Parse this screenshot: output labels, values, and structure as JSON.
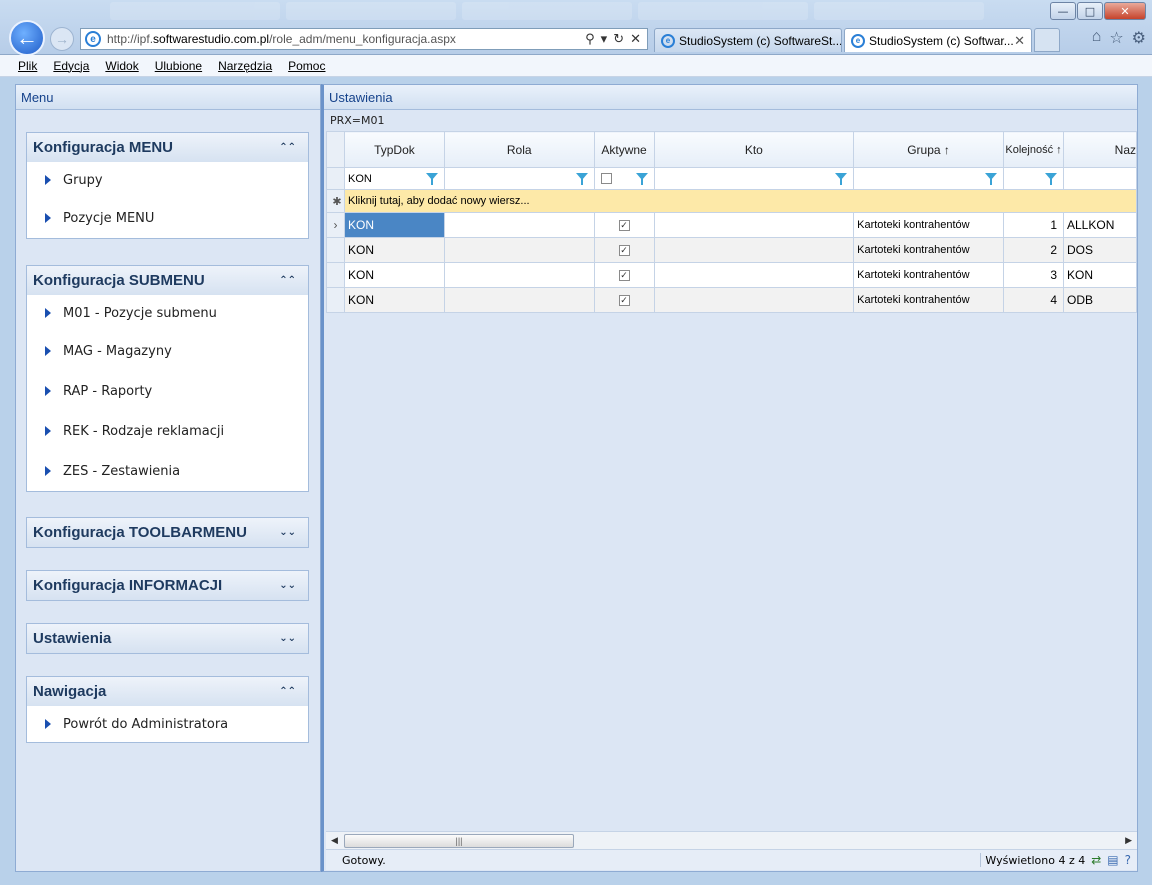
{
  "browser": {
    "url_prefix": "http://ipf.",
    "url_host": "softwarestudio.com.pl",
    "url_path": "/role_adm/menu_konfiguracja.aspx",
    "tabs": [
      {
        "title": "StudioSystem (c) SoftwareSt..."
      },
      {
        "title": "StudioSystem (c) Softwar..."
      }
    ]
  },
  "menubar": [
    "Plik",
    "Edycja",
    "Widok",
    "Ulubione",
    "Narzędzia",
    "Pomoc"
  ],
  "left_panel": {
    "title": "Menu",
    "groups": [
      {
        "title": "Konfiguracja MENU",
        "items": [
          "Grupy",
          "Pozycje MENU"
        ]
      },
      {
        "title": "Konfiguracja SUBMENU",
        "items": [
          "M01 - Pozycje submenu",
          "MAG - Magazyny",
          "RAP - Raporty",
          "REK - Rodzaje reklamacji",
          "ZES - Zestawienia"
        ]
      },
      {
        "title": "Konfiguracja TOOLBARMENU",
        "items": []
      },
      {
        "title": "Konfiguracja INFORMACJI",
        "items": []
      },
      {
        "title": "Ustawienia",
        "items": []
      },
      {
        "title": "Nawigacja",
        "items": [
          "Powrót do Administratora"
        ]
      }
    ]
  },
  "right_panel": {
    "title": "Ustawienia",
    "prx": "PRX=M01",
    "columns": [
      "TypDok",
      "Rola",
      "Aktywne",
      "Kto",
      "Grupa ↑",
      "Kolejność ↑",
      "Naz"
    ],
    "filter_typdok": "KON",
    "add_row_text": "Kliknij tutaj, aby dodać nowy wiersz...",
    "rows": [
      {
        "typdok": "KON",
        "rola": "",
        "aktywne": true,
        "kto": "",
        "grupa": "Kartoteki kontrahentów",
        "kolejnosc": "1",
        "nazwa": "ALLKON"
      },
      {
        "typdok": "KON",
        "rola": "",
        "aktywne": true,
        "kto": "",
        "grupa": "Kartoteki kontrahentów",
        "kolejnosc": "2",
        "nazwa": "DOS"
      },
      {
        "typdok": "KON",
        "rola": "",
        "aktywne": true,
        "kto": "",
        "grupa": "Kartoteki kontrahentów",
        "kolejnosc": "3",
        "nazwa": "KON"
      },
      {
        "typdok": "KON",
        "rola": "",
        "aktywne": true,
        "kto": "",
        "grupa": "Kartoteki kontrahentów",
        "kolejnosc": "4",
        "nazwa": "ODB"
      }
    ],
    "status_left": "Gotowy.",
    "status_right": "Wyświetlono 4 z 4"
  }
}
